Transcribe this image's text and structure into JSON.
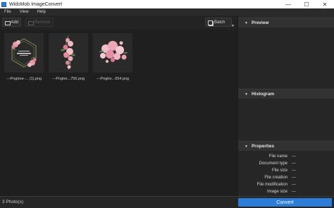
{
  "window": {
    "title": "WidsMob ImageConvert",
    "controls": [
      "—",
      "☐",
      "✕"
    ]
  },
  "menu": [
    "File",
    "View",
    "Help"
  ],
  "toolbar": {
    "add_label": "Add",
    "remove_label": "Remove",
    "batch_label": "Batch"
  },
  "thumbnails": [
    {
      "caption": "---Pngtree-... (1).png",
      "icon": "floral-frame-image"
    },
    {
      "caption": "---Pngtre...756.png",
      "icon": "flower-garland-image"
    },
    {
      "caption": "---Pngtre...654.png",
      "icon": "flower-bouquet-image"
    }
  ],
  "panels": {
    "preview": "Preview",
    "histogram": "Histogram",
    "properties": "Properties"
  },
  "properties": [
    {
      "label": "File name",
      "value": "---"
    },
    {
      "label": "Document type",
      "value": "---"
    },
    {
      "label": "File size",
      "value": "---"
    },
    {
      "label": "File creation",
      "value": "---"
    },
    {
      "label": "File modification",
      "value": "---"
    },
    {
      "label": "Image size",
      "value": "---"
    }
  ],
  "status": {
    "count_text": "3 Photo(s)",
    "convert_label": "Convert"
  },
  "colors": {
    "accent": "#2c7dd8",
    "background": "#1e1e1e",
    "panel": "#2a2a2a"
  }
}
